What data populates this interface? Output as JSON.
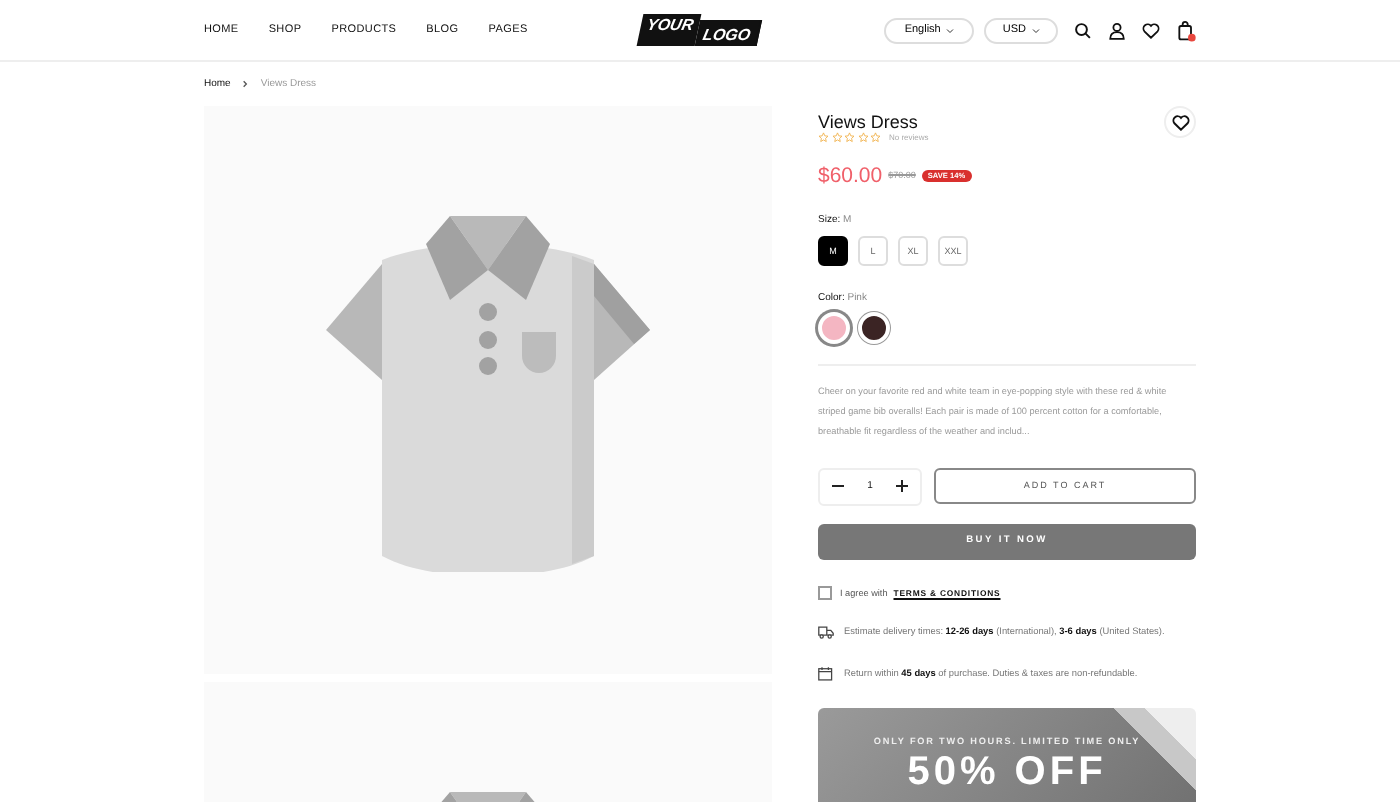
{
  "nav": [
    {
      "label": "HOME"
    },
    {
      "label": "SHOP"
    },
    {
      "label": "PRODUCTS"
    },
    {
      "label": "BLOG"
    },
    {
      "label": "PAGES"
    }
  ],
  "logo": {
    "first": "YOUR",
    "second": "LOGO"
  },
  "language": "English",
  "currency": "USD",
  "breadcrumb": [
    "Home",
    "Views Dress"
  ],
  "product": {
    "title": "Views Dress",
    "stars": 0,
    "reviews": "No reviews",
    "price": "$60.00",
    "compare_price": "$70.00",
    "badge": "SAVE 14%",
    "size_label": "Size:",
    "size_value": "M",
    "sizes": [
      {
        "label": "M",
        "selected": true
      },
      {
        "label": "L",
        "selected": false
      },
      {
        "label": "XL",
        "selected": false
      },
      {
        "label": "XXL",
        "selected": false
      }
    ],
    "color_label": "Color:",
    "color_value": "Pink",
    "colors": [
      {
        "color": "#f4b6c2",
        "selected": true
      },
      {
        "color": "#3b2424",
        "selected": false
      }
    ],
    "description": "Cheer on your favorite red and white team in eye-popping style with these red & white striped game bib overalls! Each pair is made of 100 percent cotton for a comfortable, breathable fit regardless of the weather and includ...",
    "quantity": "1",
    "add_to_cart": "ADD TO CART",
    "buy_now": "BUY IT NOW",
    "agree": {
      "checked": false,
      "text": "I agree with",
      "link": "TERMS & CONDITIONS"
    },
    "info": [
      {
        "kind": "delivery",
        "text": "Estimate delivery times: **12-26 days** (International), **3-6 days** (United States)."
      },
      {
        "kind": "return",
        "text": "Return within **45 days** of purchase. Duties & taxes are non-refundable."
      }
    ],
    "promo": {
      "tagline": "ONLY FOR TWO HOURS. LIMITED TIME ONLY",
      "headline": "50% OFF"
    }
  }
}
